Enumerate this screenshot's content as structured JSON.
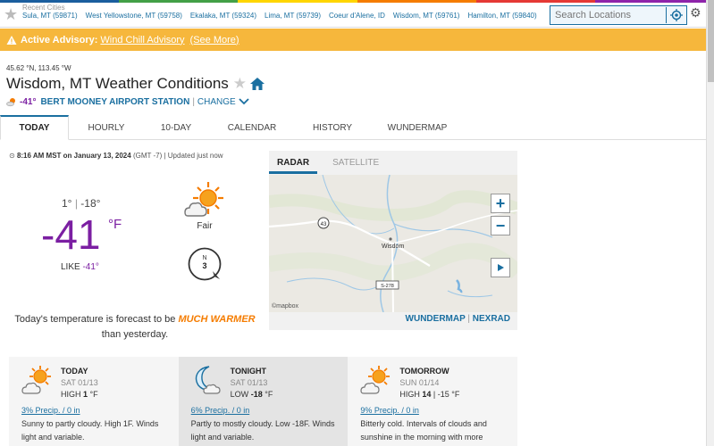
{
  "colors": {
    "stripe": [
      "#1b5e9e",
      "#43a047",
      "#ffd600",
      "#f57c00",
      "#e53935",
      "#8e24aa"
    ],
    "accent": "#1a6fa0",
    "advisory": "#f6b73c",
    "temp": "#7b1fa2",
    "warmer": "#f57c00"
  },
  "recent": {
    "label": "Recent Cities",
    "cities": [
      "Sula, MT (59871)",
      "West Yellowstone, MT (59758)",
      "Ekalaka, MT (59324)",
      "Lima, MT (59739)",
      "Coeur d'Alene, ID",
      "Wisdom, MT (59761)",
      "Hamilton, MT (59840)"
    ]
  },
  "search": {
    "placeholder": "Search Locations"
  },
  "advisory": {
    "label": "Active Advisory:",
    "name": "Wind Chill Advisory",
    "more": "(See More)"
  },
  "location": {
    "coords": "45.62 °N, 113.45 °W",
    "title": "Wisdom, MT Weather Conditions",
    "station_temp": "-41°",
    "station_name": "BERT MOONEY AIRPORT STATION",
    "separator": "|",
    "change": "CHANGE"
  },
  "tabs": [
    "TODAY",
    "HOURLY",
    "10-DAY",
    "CALENDAR",
    "HISTORY",
    "WUNDERMAP"
  ],
  "current": {
    "obs_time": "8:16 AM MST on January 13, 2024",
    "gmt": "(GMT -7)",
    "updated": "| Updated just now",
    "high": "1°",
    "hilo_sep": "|",
    "low": "-18°",
    "temp": "-41",
    "unit": "°F",
    "like_label": "LIKE",
    "like_value": "-41°",
    "condition": "Fair",
    "wind_dir": "N",
    "wind_speed": "3",
    "forecast_prefix": "Today's temperature is forecast to be",
    "forecast_change": "MUCH WARMER",
    "forecast_suffix": "than yesterday."
  },
  "radar": {
    "tabs": [
      "RADAR",
      "SATELLITE"
    ],
    "town": "Wisdom",
    "route1": "43",
    "route2": "S-278",
    "attribution": "©mapbox",
    "link1": "WUNDERMAP",
    "link_sep": "|",
    "link2": "NEXRAD"
  },
  "forecast": [
    {
      "period": "TODAY",
      "date": "SAT 01/13",
      "hl_label": "HIGH",
      "hl_value": "1",
      "hl_unit": "°F",
      "hl_extra": "",
      "precip": "3% Precip. / 0 in",
      "desc": "Sunny to partly cloudy. High 1F. Winds light and variable."
    },
    {
      "period": "TONIGHT",
      "date": "SAT 01/13",
      "hl_label": "LOW",
      "hl_value": "-18",
      "hl_unit": "°F",
      "hl_extra": "",
      "precip": "6% Precip. / 0 in",
      "desc": "Partly to mostly cloudy. Low -18F. Winds light and variable."
    },
    {
      "period": "TOMORROW",
      "date": "SUN 01/14",
      "hl_label": "HIGH",
      "hl_value": "14",
      "hl_unit": "",
      "hl_extra": "| -15 °F",
      "precip": "9% Precip. / 0 in",
      "desc": "Bitterly cold. Intervals of clouds and sunshine in the morning with more"
    }
  ]
}
